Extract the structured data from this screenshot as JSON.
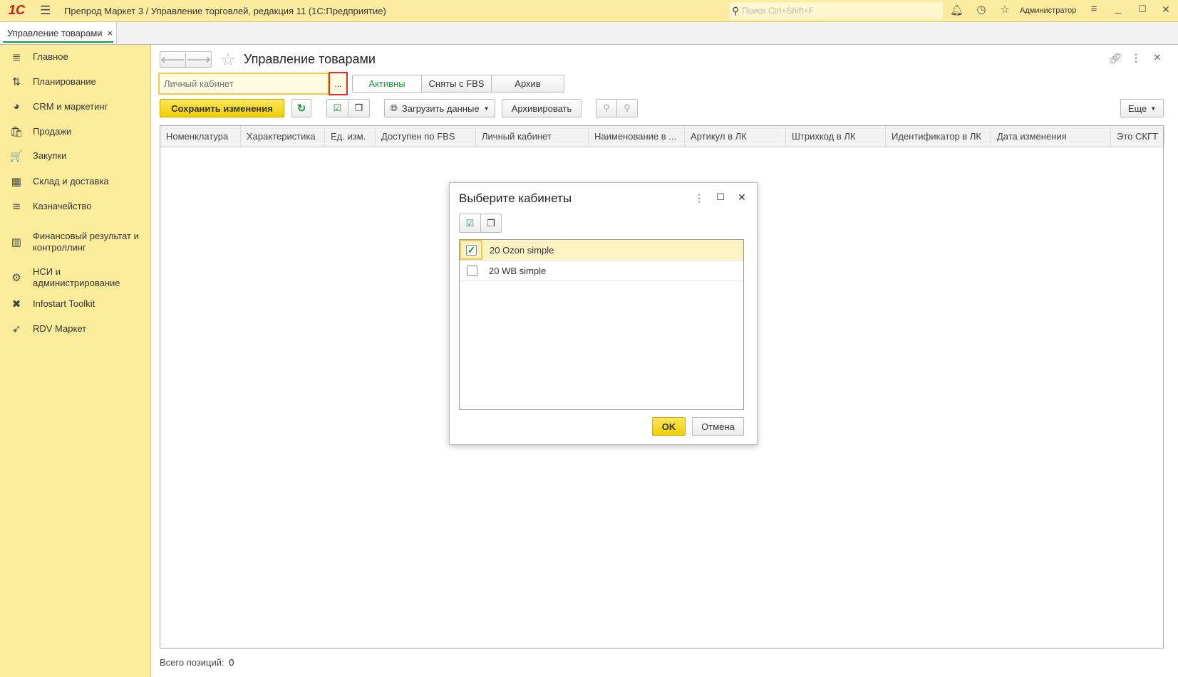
{
  "titlebar": {
    "logo": "1С",
    "title": "Препрод Маркет 3 / Управление торговлей, редакция 11  (1С:Предприятие)",
    "search_placeholder": "Поиск Ctrl+Shift+F",
    "user": "Администратор"
  },
  "tabs": [
    {
      "label": "Управление товарами",
      "close": "×"
    }
  ],
  "sidebar": {
    "items": [
      {
        "label": "Главное",
        "icon": "≣"
      },
      {
        "label": "Планирование",
        "icon": "⇅"
      },
      {
        "label": "CRM и маркетинг",
        "icon": "◕"
      },
      {
        "label": "Продажи",
        "icon": "🛍"
      },
      {
        "label": "Закупки",
        "icon": "🛒"
      },
      {
        "label": "Склад и доставка",
        "icon": "▦"
      },
      {
        "label": "Казначейство",
        "icon": "≋"
      },
      {
        "label": "Финансовый результат и контроллинг",
        "icon": "▥"
      },
      {
        "label": "НСИ и администрирование",
        "icon": "⚙"
      },
      {
        "label": "Infostart Toolkit",
        "icon": "✖"
      },
      {
        "label": "RDV Маркет",
        "icon": "➶"
      }
    ]
  },
  "form": {
    "title": "Управление товарами",
    "cabinet_placeholder": "Личный кабинет",
    "select_button": "...",
    "filters": [
      "Активны",
      "Сняты с FBS",
      "Архив"
    ],
    "active_filter_color": "#1a9a3a",
    "toolbar": {
      "save": "Сохранить изменения",
      "load": "Загрузить данные",
      "archive": "Архивировать",
      "more": "Еще"
    },
    "columns": [
      "Номенклатура",
      "Характеристика",
      "Ед. изм.",
      "Доступен по FBS",
      "Личный кабинет",
      "Наименование в ...",
      "Артикул в ЛК",
      "Штрихкод в ЛК",
      "Идентификатор в ЛК",
      "Дата изменения",
      "Это СКГТ"
    ],
    "footer_label": "Всего позиций:",
    "footer_value": "0"
  },
  "dialog": {
    "title": "Выберите кабинеты",
    "items": [
      {
        "label": "20 Ozon simple",
        "checked": true
      },
      {
        "label": "20 WB simple",
        "checked": false
      }
    ],
    "ok": "OK",
    "cancel": "Отмена"
  }
}
